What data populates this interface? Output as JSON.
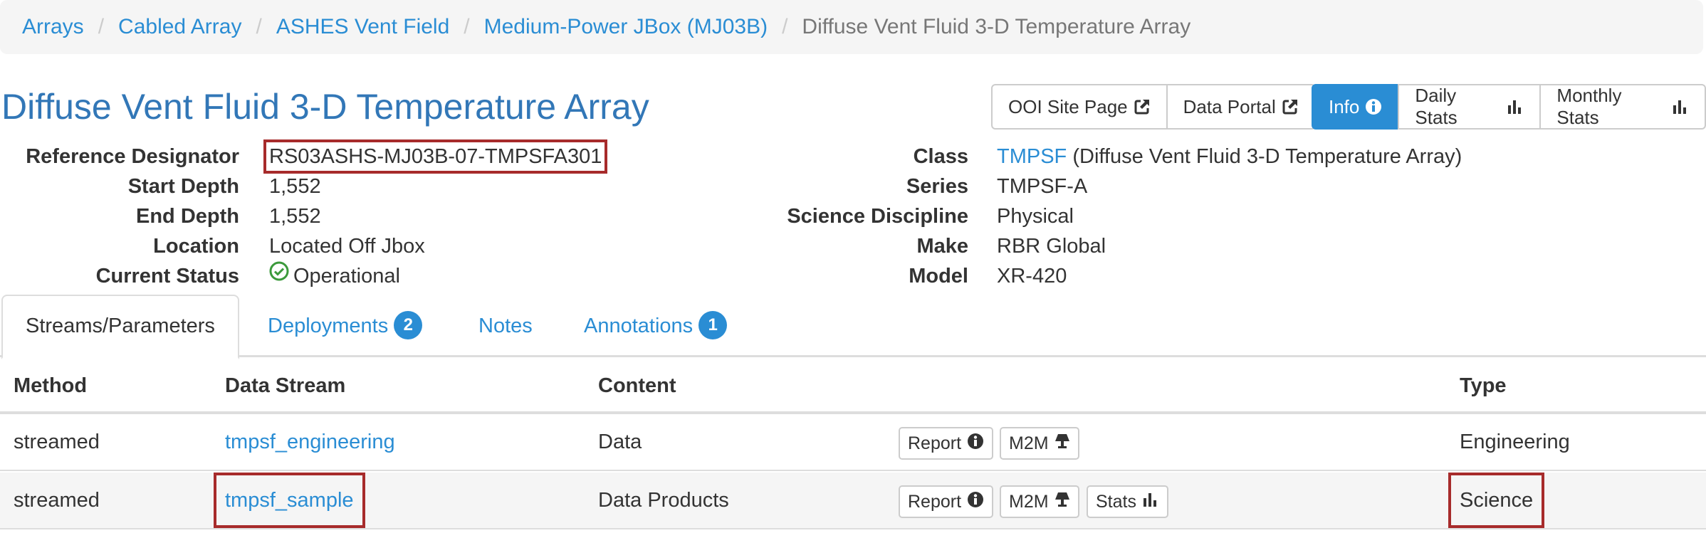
{
  "breadcrumb": {
    "items": [
      "Arrays",
      "Cabled Array",
      "ASHES Vent Field",
      "Medium-Power JBox (MJ03B)"
    ],
    "active": "Diffuse Vent Fluid 3-D Temperature Array",
    "separator": "/"
  },
  "title": "Diffuse Vent Fluid 3-D Temperature Array",
  "external_buttons": {
    "site_page": "OOI Site Page",
    "data_portal": "Data Portal",
    "icon": "external-link-icon"
  },
  "view_buttons": {
    "info": "Info",
    "daily_stats": "Daily Stats",
    "monthly_stats": "Monthly Stats"
  },
  "details_left": {
    "ref_label": "Reference Designator",
    "ref_value": "RS03ASHS-MJ03B-07-TMPSFA301",
    "start_depth_label": "Start Depth",
    "start_depth_value": "1,552",
    "end_depth_label": "End Depth",
    "end_depth_value": "1,552",
    "location_label": "Location",
    "location_value": "Located Off Jbox",
    "status_label": "Current Status",
    "status_value": "Operational"
  },
  "details_right": {
    "class_label": "Class",
    "class_link": "TMPSF",
    "class_desc": "(Diffuse Vent Fluid 3-D Temperature Array)",
    "series_label": "Series",
    "series_value": "TMPSF-A",
    "discipline_label": "Science Discipline",
    "discipline_value": "Physical",
    "make_label": "Make",
    "make_value": "RBR Global",
    "model_label": "Model",
    "model_value": "XR-420"
  },
  "tabs": {
    "streams": "Streams/Parameters",
    "deployments": "Deployments",
    "deployments_count": "2",
    "notes": "Notes",
    "annotations": "Annotations",
    "annotations_count": "1"
  },
  "table": {
    "headers": {
      "method": "Method",
      "data_stream": "Data Stream",
      "content": "Content",
      "type": "Type"
    },
    "rows": [
      {
        "method": "streamed",
        "stream": "tmpsf_engineering",
        "content": "Data",
        "report": "Report",
        "m2m": "M2M",
        "type": "Engineering"
      },
      {
        "method": "streamed",
        "stream": "tmpsf_sample",
        "content": "Data Products",
        "report": "Report",
        "m2m": "M2M",
        "stats": "Stats",
        "type": "Science"
      }
    ]
  },
  "colors": {
    "link": "#2a8dd4",
    "title": "#3277b7",
    "primary": "#2a8dd4",
    "highlight": "#a72b2b",
    "success": "#3c9a3c"
  }
}
